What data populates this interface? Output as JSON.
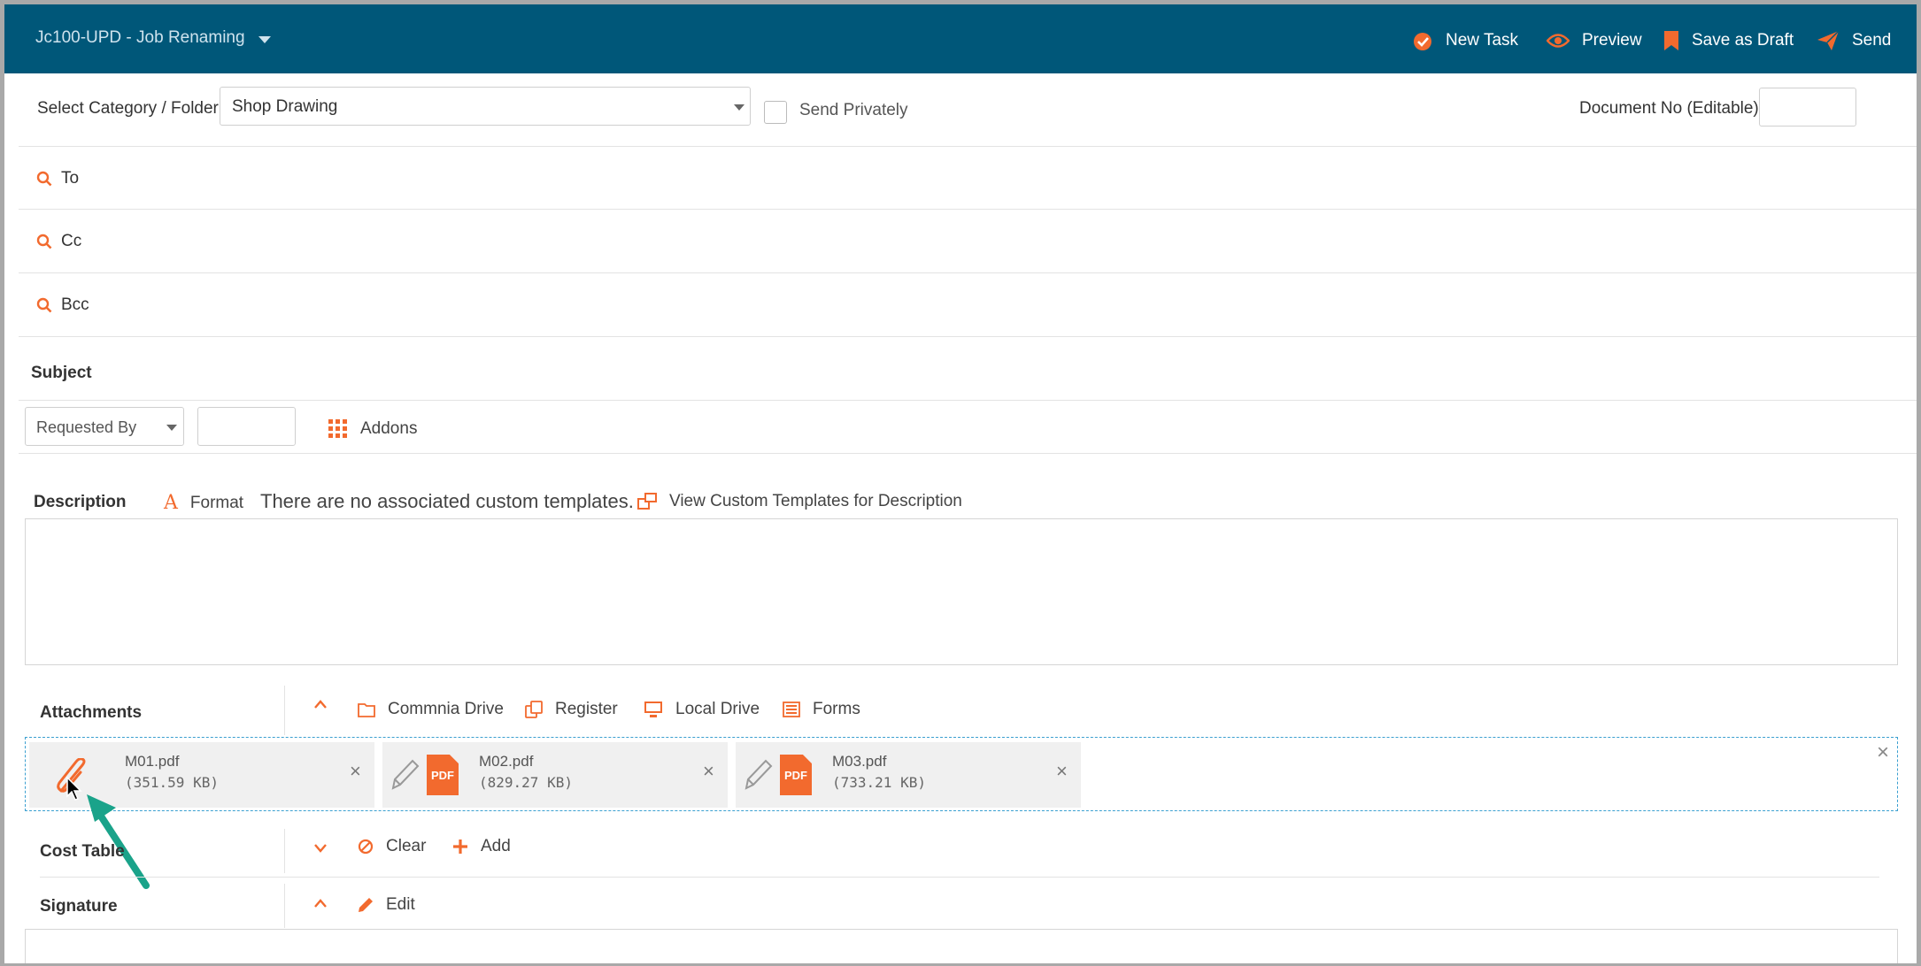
{
  "header": {
    "title": "Jc100-UPD - Job Renaming",
    "buttons": {
      "new_task": "New Task",
      "preview": "Preview",
      "save_draft": "Save as Draft",
      "send": "Send"
    }
  },
  "category": {
    "label": "Select Category / Folder",
    "value": "Shop Drawing",
    "send_privately": "Send Privately",
    "doc_no_label": "Document No (Editable):",
    "doc_no_value": ""
  },
  "recipients": {
    "to": "To",
    "cc": "Cc",
    "bcc": "Bcc"
  },
  "subject": {
    "label": "Subject",
    "requested_by": "Requested By",
    "requested_value": "",
    "addons": "Addons"
  },
  "description": {
    "label": "Description",
    "format": "Format",
    "no_templates": "There are no associated custom templates.",
    "view_templates": "View Custom Templates for Description",
    "body": ""
  },
  "attachments": {
    "label": "Attachments",
    "sources": [
      "Commnia Drive",
      "Register",
      "Local Drive",
      "Forms"
    ],
    "files": [
      {
        "name": "M01.pdf",
        "size": "(351.59 KB)"
      },
      {
        "name": "M02.pdf",
        "size": "(829.27 KB)"
      },
      {
        "name": "M03.pdf",
        "size": "(733.21 KB)"
      }
    ]
  },
  "cost_table": {
    "label": "Cost Table",
    "clear": "Clear",
    "add": "Add"
  },
  "signature": {
    "label": "Signature",
    "edit": "Edit"
  },
  "colors": {
    "header_bg": "#005779",
    "accent": "#f26a2e",
    "arrow": "#1aa38a"
  }
}
